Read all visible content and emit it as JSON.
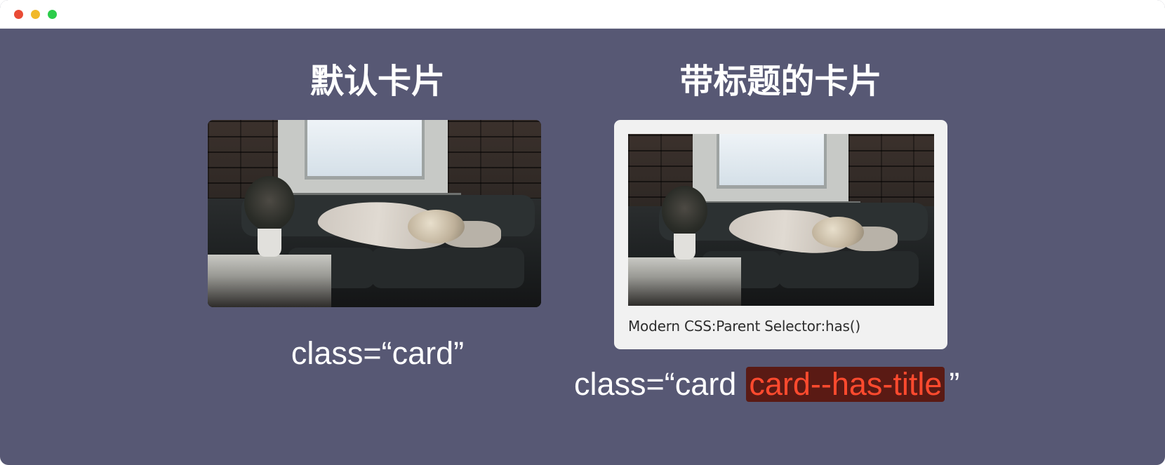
{
  "window": {
    "controls": {
      "close_color": "#e94b35",
      "minimize_color": "#f1b92a",
      "maximize_color": "#2ccc4a"
    },
    "background_color": "#575874"
  },
  "sections": {
    "default": {
      "heading": "默认卡片",
      "class_label": "class=“card”"
    },
    "titled": {
      "heading": "带标题的卡片",
      "card_title": "Modern CSS:Parent Selector:has()",
      "class_prefix": "class=“card",
      "class_highlight": "card--has-title",
      "class_suffix": "”",
      "highlight_color": "#ff4a2e"
    }
  }
}
